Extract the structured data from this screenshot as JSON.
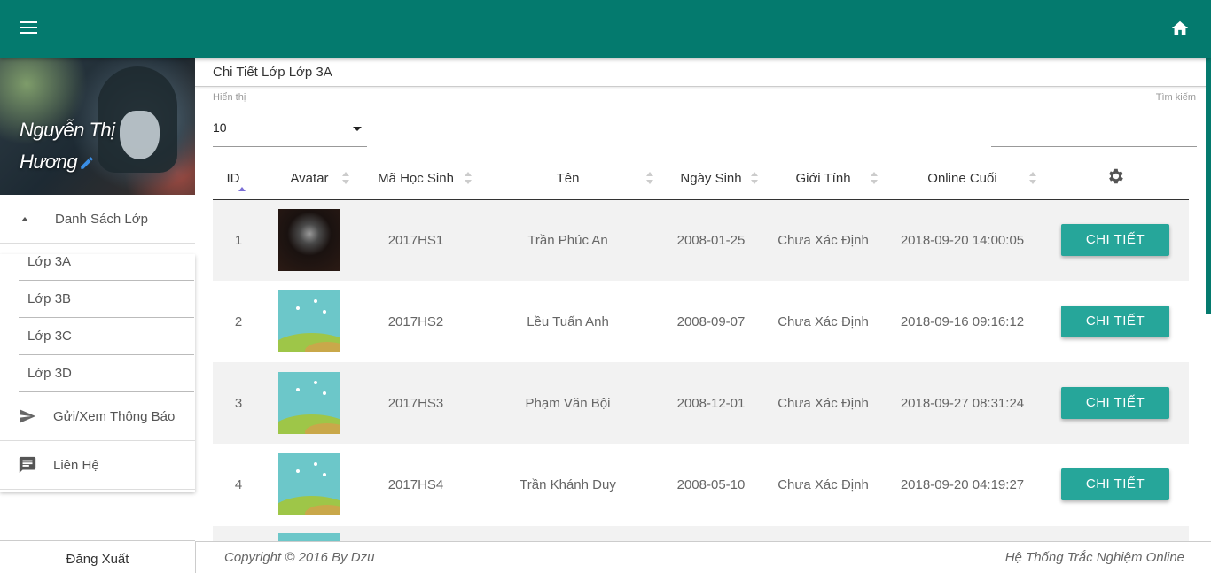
{
  "header": {
    "menu_icon": "hamburger-menu-icon",
    "home_icon": "home-icon",
    "bg_color": "#047a6e"
  },
  "sidebar": {
    "user_name_line1": "Nguyễn Thị",
    "user_name_line2": "Hương",
    "class_group_label": "Danh Sách Lớp",
    "classes": [
      "Lớp 3A",
      "Lớp 3B",
      "Lớp 3C",
      "Lớp 3D"
    ],
    "notify_label": "Gửi/Xem Thông Báo",
    "contact_label": "Liên Hệ",
    "logout_label": "Đăng Xuất"
  },
  "main": {
    "breadcrumb": "Chi Tiết Lớp Lớp 3A",
    "show_label": "Hiển thị",
    "show_value": "10",
    "search_label": "Tìm kiếm",
    "search_value": "",
    "columns": [
      "ID",
      "Avatar",
      "Mã Học Sinh",
      "Tên",
      "Ngày Sinh",
      "Giới Tính",
      "Online Cuối"
    ],
    "settings_icon": "gear-icon",
    "rows": [
      {
        "id": "1",
        "avatar": "dark",
        "code": "2017HS1",
        "name": "Trần Phúc An",
        "dob": "2008-01-25",
        "gender": "Chưa Xác Định",
        "last_online": "2018-09-20 14:00:05",
        "action": "CHI TIẾT"
      },
      {
        "id": "2",
        "avatar": "scene",
        "code": "2017HS2",
        "name": "Lều Tuấn Anh",
        "dob": "2008-09-07",
        "gender": "Chưa Xác Định",
        "last_online": "2018-09-16 09:16:12",
        "action": "CHI TIẾT"
      },
      {
        "id": "3",
        "avatar": "scene",
        "code": "2017HS3",
        "name": "Phạm Văn Bội",
        "dob": "2008-12-01",
        "gender": "Chưa Xác Định",
        "last_online": "2018-09-27 08:31:24",
        "action": "CHI TIẾT"
      },
      {
        "id": "4",
        "avatar": "scene",
        "code": "2017HS4",
        "name": "Trần Khánh Duy",
        "dob": "2008-05-10",
        "gender": "Chưa Xác Định",
        "last_online": "2018-09-20 04:19:27",
        "action": "CHI TIẾT"
      }
    ]
  },
  "footer": {
    "copyright": "Copyright © 2016 By Dzu",
    "system_name": "Hệ Thống Trắc Nghiệm Online"
  },
  "colors": {
    "accent": "#26a69a",
    "sort_active": "#7b6fd6"
  }
}
